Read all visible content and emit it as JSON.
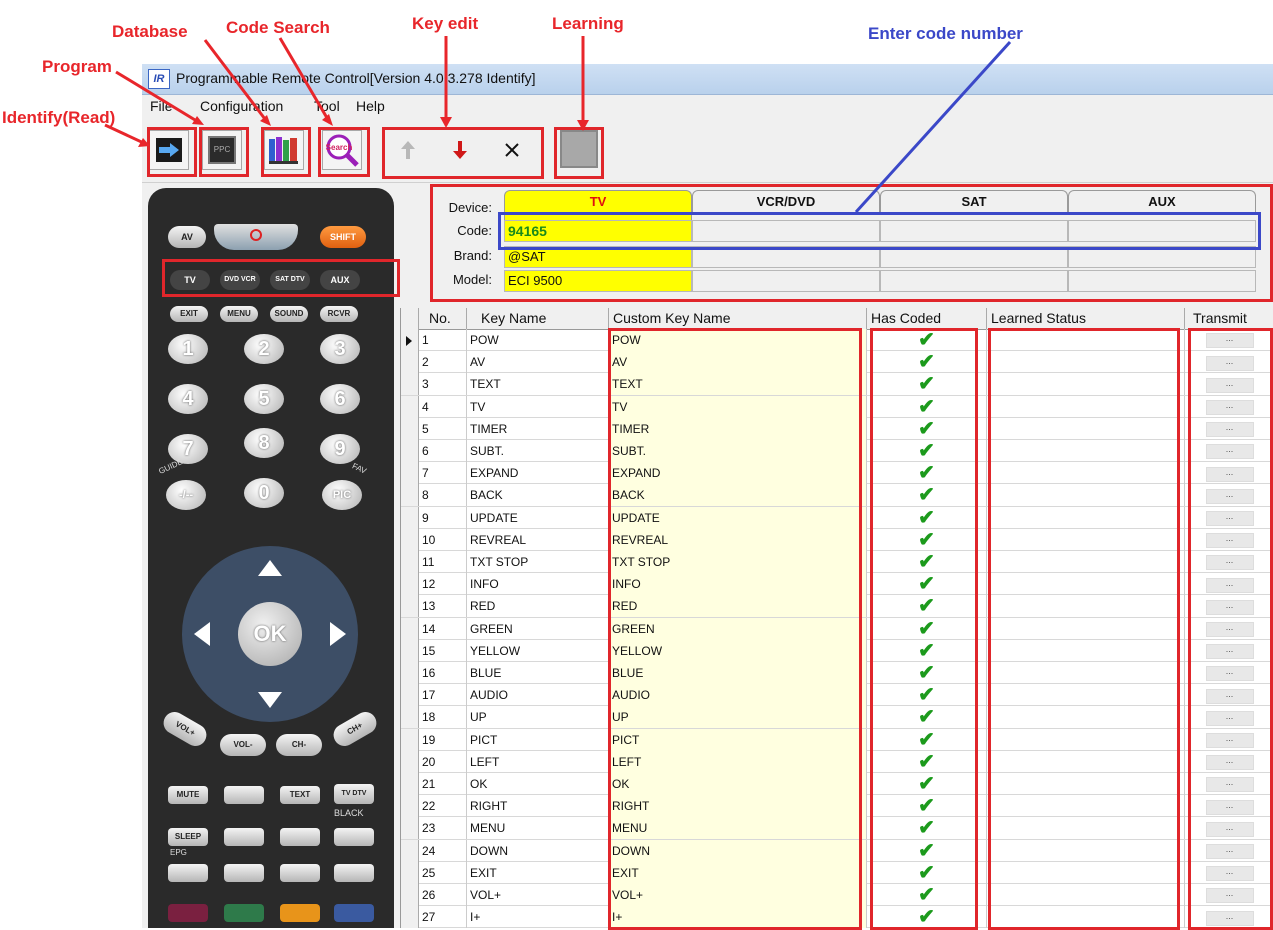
{
  "annotations": {
    "identify": "Identify(Read)",
    "program": "Program",
    "database": "Database",
    "code_search": "Code Search",
    "key_edit": "Key edit",
    "learning": "Learning",
    "enter_code": "Enter code number"
  },
  "window": {
    "icon_text": "IR",
    "title": "Programmable Remote Control[Version 4.0.3.278 Identify]"
  },
  "menu": [
    "File",
    "Configuration",
    "Tool",
    "Help"
  ],
  "toolbar": {
    "program_chip_label": "PPC",
    "search_label": "Search"
  },
  "remote": {
    "top_buttons": [
      "AV",
      "SHIFT"
    ],
    "device_buttons": [
      "TV",
      "DVD VCR",
      "SAT DTV",
      "AUX"
    ],
    "row3": [
      "EXIT",
      "MENU",
      "SOUND",
      "RCVR"
    ],
    "numbers": [
      "1",
      "2",
      "3",
      "4",
      "5",
      "6",
      "7",
      "8",
      "9",
      "-/--",
      "0",
      "PIC"
    ],
    "guide_label": "GUIDE",
    "fav_label": "FAV",
    "ok_label": "OK",
    "vol_ch": [
      "VOL+",
      "VOL-",
      "CH-",
      "CH+"
    ],
    "bottom_row1": [
      "MUTE",
      "",
      "TEXT",
      "TV DTV"
    ],
    "black_label": "BLACK",
    "sleep_label": "SLEEP",
    "epg_label": "EPG"
  },
  "device": {
    "labels": {
      "device": "Device:",
      "code": "Code:",
      "brand": "Brand:",
      "model": "Model:"
    },
    "tabs": [
      "TV",
      "VCR/DVD",
      "SAT",
      "AUX"
    ],
    "code": "94165",
    "brand": "@SAT",
    "model": "ECI 9500",
    "colors": {
      "active_tab": "#ffff00",
      "active_tab_text": "#e01010",
      "code_text": "#1a8a1a"
    }
  },
  "grid": {
    "headers": [
      "No.",
      "Key Name",
      "Custom Key Name",
      "Has Coded",
      "Learned Status",
      "Transmit"
    ],
    "transmit_label": "...",
    "rows": [
      {
        "no": "1",
        "key": "POW",
        "custom": "POW"
      },
      {
        "no": "2",
        "key": "AV",
        "custom": "AV"
      },
      {
        "no": "3",
        "key": "TEXT",
        "custom": "TEXT"
      },
      {
        "no": "4",
        "key": "TV",
        "custom": "TV"
      },
      {
        "no": "5",
        "key": "TIMER",
        "custom": "TIMER"
      },
      {
        "no": "6",
        "key": "SUBT.",
        "custom": "SUBT."
      },
      {
        "no": "7",
        "key": "EXPAND",
        "custom": "EXPAND"
      },
      {
        "no": "8",
        "key": "BACK",
        "custom": "BACK"
      },
      {
        "no": "9",
        "key": "UPDATE",
        "custom": "UPDATE"
      },
      {
        "no": "10",
        "key": "REVREAL",
        "custom": "REVREAL"
      },
      {
        "no": "11",
        "key": "TXT STOP",
        "custom": "TXT STOP"
      },
      {
        "no": "12",
        "key": "INFO",
        "custom": "INFO"
      },
      {
        "no": "13",
        "key": "RED",
        "custom": "RED"
      },
      {
        "no": "14",
        "key": "GREEN",
        "custom": "GREEN"
      },
      {
        "no": "15",
        "key": "YELLOW",
        "custom": "YELLOW"
      },
      {
        "no": "16",
        "key": "BLUE",
        "custom": "BLUE"
      },
      {
        "no": "17",
        "key": "AUDIO",
        "custom": "AUDIO"
      },
      {
        "no": "18",
        "key": "UP",
        "custom": "UP"
      },
      {
        "no": "19",
        "key": "PICT",
        "custom": "PICT"
      },
      {
        "no": "20",
        "key": "LEFT",
        "custom": "LEFT"
      },
      {
        "no": "21",
        "key": "OK",
        "custom": "OK"
      },
      {
        "no": "22",
        "key": "RIGHT",
        "custom": "RIGHT"
      },
      {
        "no": "23",
        "key": "MENU",
        "custom": "MENU"
      },
      {
        "no": "24",
        "key": "DOWN",
        "custom": "DOWN"
      },
      {
        "no": "25",
        "key": "EXIT",
        "custom": "EXIT"
      },
      {
        "no": "26",
        "key": "VOL+",
        "custom": "VOL+"
      },
      {
        "no": "27",
        "key": "I+",
        "custom": "I+"
      }
    ]
  }
}
